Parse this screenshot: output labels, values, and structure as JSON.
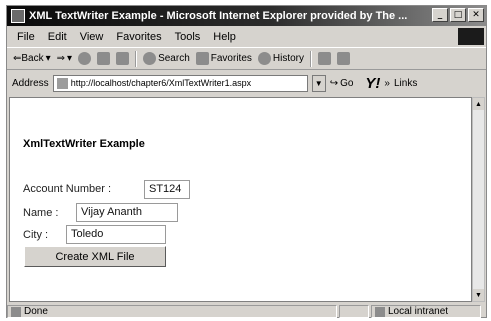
{
  "window": {
    "title": "XML TextWriter Example - Microsoft Internet Explorer provided by The ...",
    "buttons": [
      "_",
      "□",
      "✕"
    ]
  },
  "menu": [
    "File",
    "Edit",
    "View",
    "Favorites",
    "Tools",
    "Help"
  ],
  "toolbar": {
    "back": "⇐Back",
    "forward": "⇒",
    "search": "Search",
    "favorites": "Favorites",
    "history": "History"
  },
  "address": {
    "label": "Address",
    "url": "http://localhost/chapter6/XmlTextWriter1.aspx",
    "go": "Go",
    "links": "Links",
    "logo": "Y!"
  },
  "page": {
    "heading": "XmlTextWriter Example",
    "account_label": "Account Number :",
    "account_value": "ST124",
    "name_label": "Name :",
    "name_value": "Vijay Ananth",
    "city_label": "City :",
    "city_value": "Toledo",
    "button": "Create XML File"
  },
  "status": {
    "left": "Done",
    "zone": "Local intranet"
  }
}
